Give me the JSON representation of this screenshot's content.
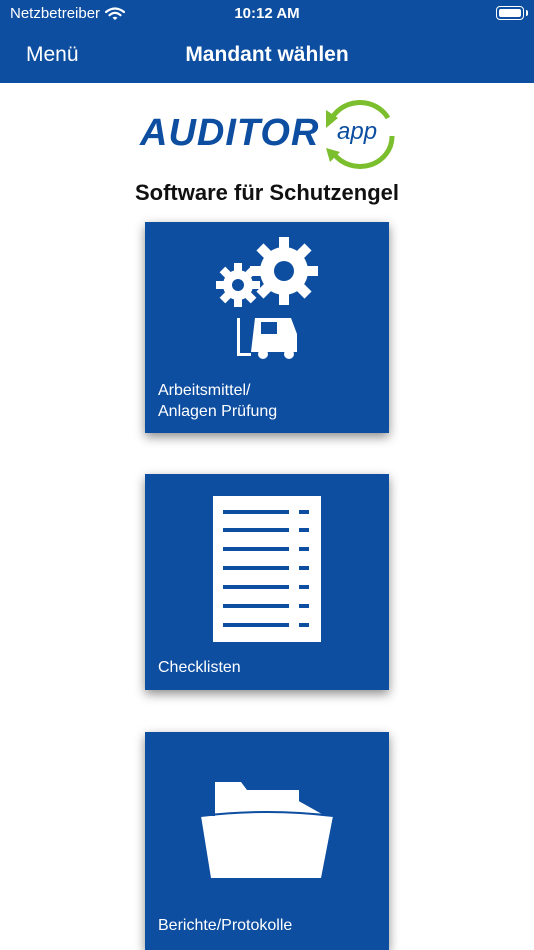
{
  "status_bar": {
    "carrier": "Netzbetreiber",
    "time": "10:12 AM"
  },
  "nav": {
    "menu_label": "Menü",
    "title": "Mandant wählen"
  },
  "logo": {
    "main_text": "AUDITOR",
    "suffix_text": "app"
  },
  "tagline": "Software für Schutzengel",
  "tiles": [
    {
      "label_line1": "Arbeitsmittel/",
      "label_line2": "Anlagen Prüfung",
      "icon": "gears-forklift-icon"
    },
    {
      "label_line1": "Checklisten",
      "icon": "checklist-icon"
    },
    {
      "label_line1": "Berichte/Protokolle",
      "icon": "folder-icon"
    }
  ],
  "colors": {
    "brand_blue": "#0d4ea1",
    "accent_green": "#7cbf2e",
    "background": "#ffffff"
  }
}
